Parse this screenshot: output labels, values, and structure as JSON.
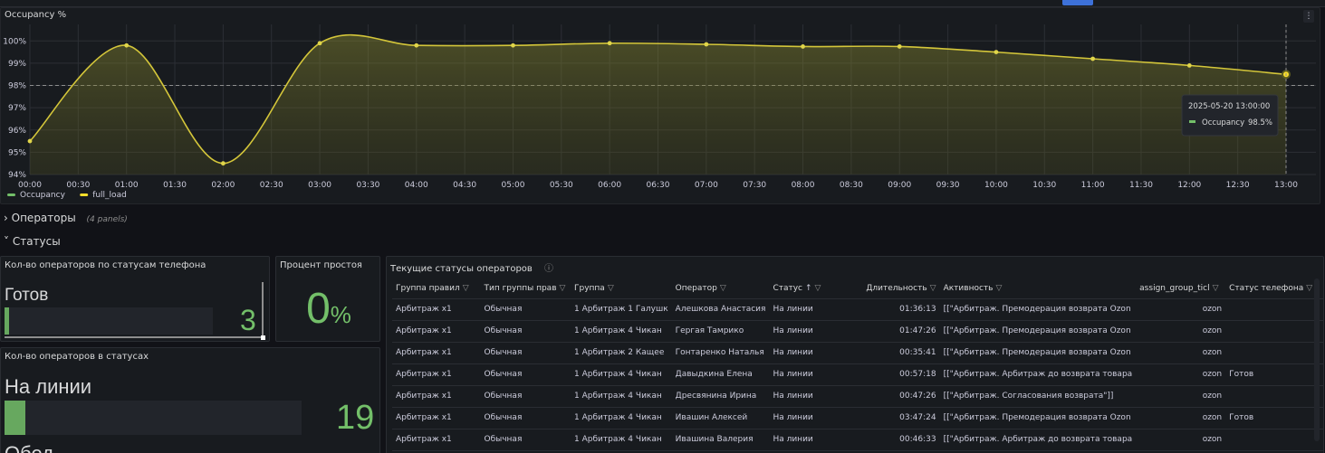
{
  "chart_panel": {
    "title": "Occupancy %",
    "menu_icon": "more-vertical-icon"
  },
  "chart_data": {
    "type": "line",
    "x": [
      "00:00",
      "01:00",
      "02:00",
      "03:00",
      "04:00",
      "05:00",
      "06:00",
      "07:00",
      "08:00",
      "09:00",
      "10:00",
      "11:00",
      "12:00",
      "13:00"
    ],
    "xticks": [
      "00:00",
      "00:30",
      "01:00",
      "01:30",
      "02:00",
      "02:30",
      "03:00",
      "03:30",
      "04:00",
      "04:30",
      "05:00",
      "05:30",
      "06:00",
      "06:30",
      "07:00",
      "07:30",
      "08:00",
      "08:30",
      "09:00",
      "09:30",
      "10:00",
      "10:30",
      "11:00",
      "11:30",
      "12:00",
      "12:30",
      "13:00"
    ],
    "series": [
      {
        "name": "Occupancy",
        "color": "#73bf69",
        "values": [
          95.5,
          99.8,
          94.5,
          99.9,
          99.8,
          99.8,
          99.9,
          99.85,
          99.75,
          99.75,
          99.5,
          99.2,
          98.9,
          98.5
        ]
      },
      {
        "name": "full_load",
        "color": "#fade2a",
        "values": []
      }
    ],
    "ylim": [
      94,
      100.5
    ],
    "yticks": [
      "100%",
      "99%",
      "98%",
      "97%",
      "96%",
      "95%",
      "94%"
    ],
    "threshold": 98,
    "grid": true,
    "legend": "bottom-left",
    "tooltip": {
      "time": "2025-05-20 13:00:00",
      "series": "Occupancy",
      "value": "98.5%"
    }
  },
  "rows": {
    "operators": {
      "label": "Операторы",
      "sub": "(4 panels)"
    },
    "statuses": {
      "label": "Статусы"
    }
  },
  "phone_status_panel": {
    "title": "Кол-во операторов по статусам телефона",
    "label": "Готов",
    "value": "3",
    "fill": 0.02
  },
  "idle_panel": {
    "title": "Процент простоя",
    "value": "0",
    "unit": "%"
  },
  "status_count_panel": {
    "title": "Кол-во операторов в статусах",
    "label": "На линии",
    "value": "19",
    "fill": 0.07,
    "label2": "Обед"
  },
  "table_panel": {
    "title": "Текущие статусы операторов",
    "info_icon": "info-icon",
    "columns": [
      "Группа правил",
      "Тип группы прав",
      "Группа",
      "Оператор",
      "Статус",
      "Длительность",
      "Активность",
      "assign_group_ticl",
      "Статус телефона"
    ],
    "rows": [
      [
        "Арбитраж x1",
        "Обычная",
        "1 Арбитраж 1 Галушк",
        "Алешкова Анастасия",
        "На линии",
        "01:36:13",
        "[[\"Арбитраж. Премодерация возврата Ozon",
        "ozon",
        ""
      ],
      [
        "Арбитраж x1",
        "Обычная",
        "1 Арбитраж 4 Чикан",
        "Гергая Тамрико",
        "На линии",
        "01:47:26",
        "[[\"Арбитраж. Премодерация возврата Ozon",
        "ozon",
        ""
      ],
      [
        "Арбитраж x1",
        "Обычная",
        "1 Арбитраж 2 Кащее",
        "Гонтаренко Наталья",
        "На линии",
        "00:35:41",
        "[[\"Арбитраж. Премодерация возврата Ozon",
        "ozon",
        ""
      ],
      [
        "Арбитраж x1",
        "Обычная",
        "1 Арбитраж 4 Чикан",
        "Давыдкина Елена",
        "На линии",
        "00:57:18",
        "[[\"Арбитраж. Арбитраж до возврата товара",
        "ozon",
        "Готов"
      ],
      [
        "Арбитраж x1",
        "Обычная",
        "1 Арбитраж 4 Чикан",
        "Дресвянина Ирина",
        "На линии",
        "00:47:26",
        "[[\"Арбитраж. Согласования возврата\"]]",
        "ozon",
        ""
      ],
      [
        "Арбитраж x1",
        "Обычная",
        "1 Арбитраж 4 Чикан",
        "Ивашин Алексей",
        "На линии",
        "03:47:24",
        "[[\"Арбитраж. Премодерация возврата Ozon",
        "ozon",
        "Готов"
      ],
      [
        "Арбитраж x1",
        "Обычная",
        "1 Арбитраж 4 Чикан",
        "Ивашина Валерия",
        "На линии",
        "00:46:33",
        "[[\"Арбитраж. Арбитраж до возврата товара",
        "ozon",
        ""
      ]
    ]
  }
}
